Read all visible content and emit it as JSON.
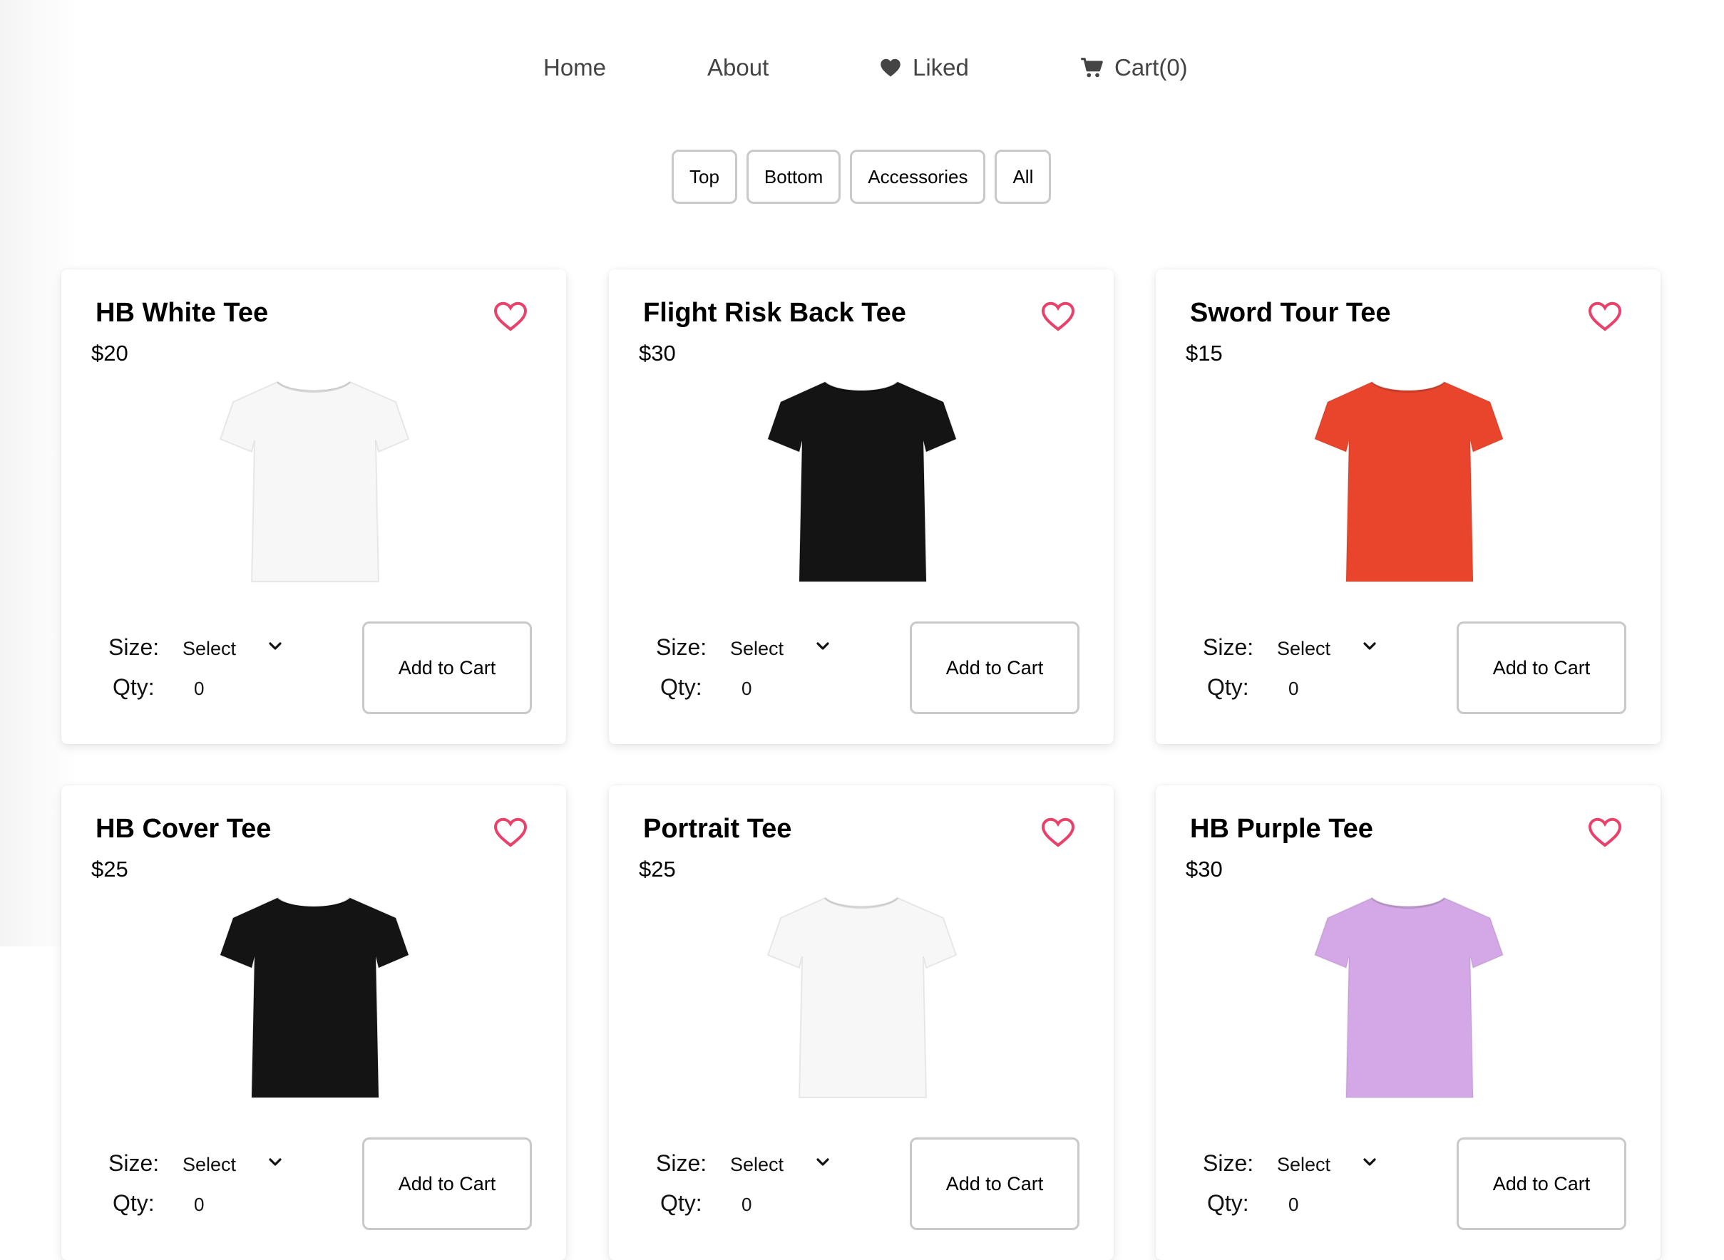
{
  "nav": {
    "home": "Home",
    "about": "About",
    "liked": "Liked",
    "cart": "Cart(0)"
  },
  "filters": [
    "Top",
    "Bottom",
    "Accessories",
    "All"
  ],
  "labels": {
    "size": "Size:",
    "qty": "Qty:",
    "size_placeholder": "Select",
    "add_to_cart": "Add to Cart"
  },
  "products": [
    {
      "name": "HB White Tee",
      "price": "$20",
      "shirt_color": "#f7f7f7",
      "qty": "0"
    },
    {
      "name": "Flight Risk Back Tee",
      "price": "$30",
      "shirt_color": "#141414",
      "qty": "0"
    },
    {
      "name": "Sword Tour Tee",
      "price": "$15",
      "shirt_color": "#e8452c",
      "qty": "0"
    },
    {
      "name": "HB Cover Tee",
      "price": "$25",
      "shirt_color": "#141414",
      "qty": "0"
    },
    {
      "name": "Portrait Tee",
      "price": "$25",
      "shirt_color": "#f7f7f7",
      "qty": "0"
    },
    {
      "name": "HB Purple Tee",
      "price": "$30",
      "shirt_color": "#d4a7e6",
      "qty": "0"
    }
  ],
  "colors": {
    "heart": "#e8426a",
    "nav_text": "#444444",
    "border": "#c9c9c9"
  },
  "icons": {
    "liked": "heart-icon",
    "cart": "cart-icon",
    "wishlist": "heart-outline-icon",
    "dropdown": "chevron-down-icon"
  }
}
